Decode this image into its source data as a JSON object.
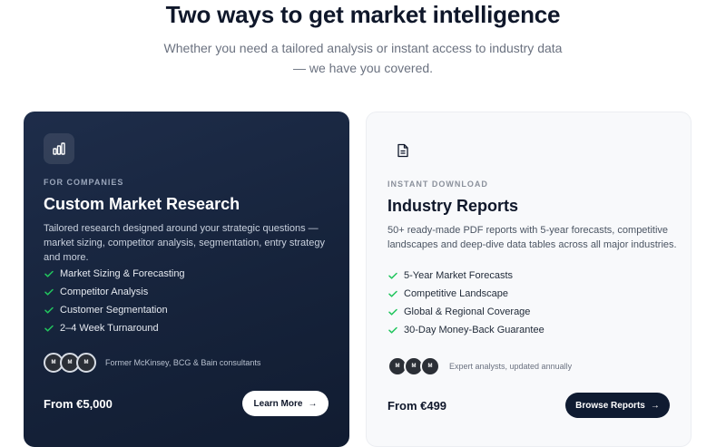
{
  "header": {
    "title": "Two ways to get market intelligence",
    "subtitle": "Whether you need a tailored analysis or instant access to industry data — we have you covered."
  },
  "colors": {
    "dark_card": "#16233b",
    "check_green": "#22c55e",
    "dark_button": "#0f1b31"
  },
  "cards": {
    "research": {
      "icon": "bar-chart-icon",
      "eyebrow": "FOR COMPANIES",
      "title": "Custom Market Research",
      "description": "Tailored research designed around your strategic questions — market sizing, competitor analysis, segmentation, entry strategy and more.",
      "features": [
        "Market Sizing & Forecasting",
        "Competitor Analysis",
        "Customer Segmentation",
        "2–4 Week Turnaround"
      ],
      "avatar_caption": "Former McKinsey, BCG & Bain consultants",
      "price": "From €5,000",
      "cta": "Learn More",
      "cta_arrow": "→"
    },
    "reports": {
      "icon": "document-icon",
      "eyebrow": "INSTANT DOWNLOAD",
      "title": "Industry Reports",
      "description": "50+ ready-made PDF reports with 5-year forecasts, competitive landscapes and deep-dive data tables across all major industries.",
      "features": [
        "5-Year Market Forecasts",
        "Competitive Landscape",
        "Global & Regional Coverage",
        "30-Day Money-Back Guarantee"
      ],
      "avatar_caption": "Expert analysts, updated annually",
      "price": "From €499",
      "cta": "Browse Reports",
      "cta_arrow": "→"
    }
  }
}
